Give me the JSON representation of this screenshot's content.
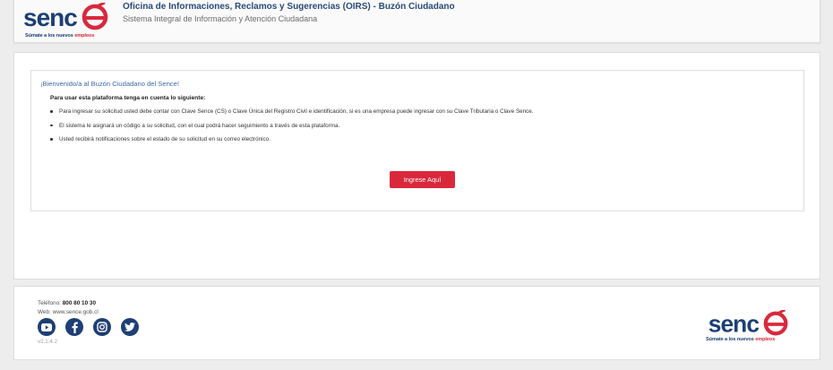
{
  "header": {
    "logo": {
      "word": "sence",
      "tagline_main": "Súmate a los nuevos",
      "tagline_accent": "empleos"
    },
    "title": "Oficina de Informaciones, Reclamos y Sugerencias (OIRS) - Buzón Ciudadano",
    "subtitle": "Sistema Integral de Información y Atención Ciudadana"
  },
  "main": {
    "welcome": "¡Bienvenido/a al Buzón Ciudadano del Sence!",
    "intro": "Para usar esta plataforma tenga en cuenta lo siguiente:",
    "bullets": [
      "Para ingresar su solicitud usted debe contar con Clave Sence (CS) o Clave Única del Registro Civil e identificación, si es una empresa puede ingresar con su Clave Tributaria o Clave Sence.",
      "El sistema le asignará un código a su solicitud, con el cual podrá hacer seguimiento a través de esta plataforma.",
      "Usted recibirá notificaciones sobre el estado de su solicitud en su correo electrónico."
    ],
    "button_label": "Ingrese Aquí"
  },
  "footer": {
    "phone_label": "Teléfono:",
    "phone_value": "800 80 10 30",
    "web_label": "Web:",
    "web_value": "www.sence.gob.cl",
    "socials": [
      "youtube-icon",
      "facebook-icon",
      "instagram-icon",
      "twitter-icon"
    ],
    "version": "v2.1.4.2",
    "logo": {
      "word": "sence",
      "tagline_main": "Súmate a los nuevos",
      "tagline_accent": "empleos"
    }
  },
  "colors": {
    "brand_navy": "#1d3f75",
    "brand_red": "#d9283c",
    "title_blue": "#2a4a7a",
    "link_blue": "#3e6aa8"
  }
}
